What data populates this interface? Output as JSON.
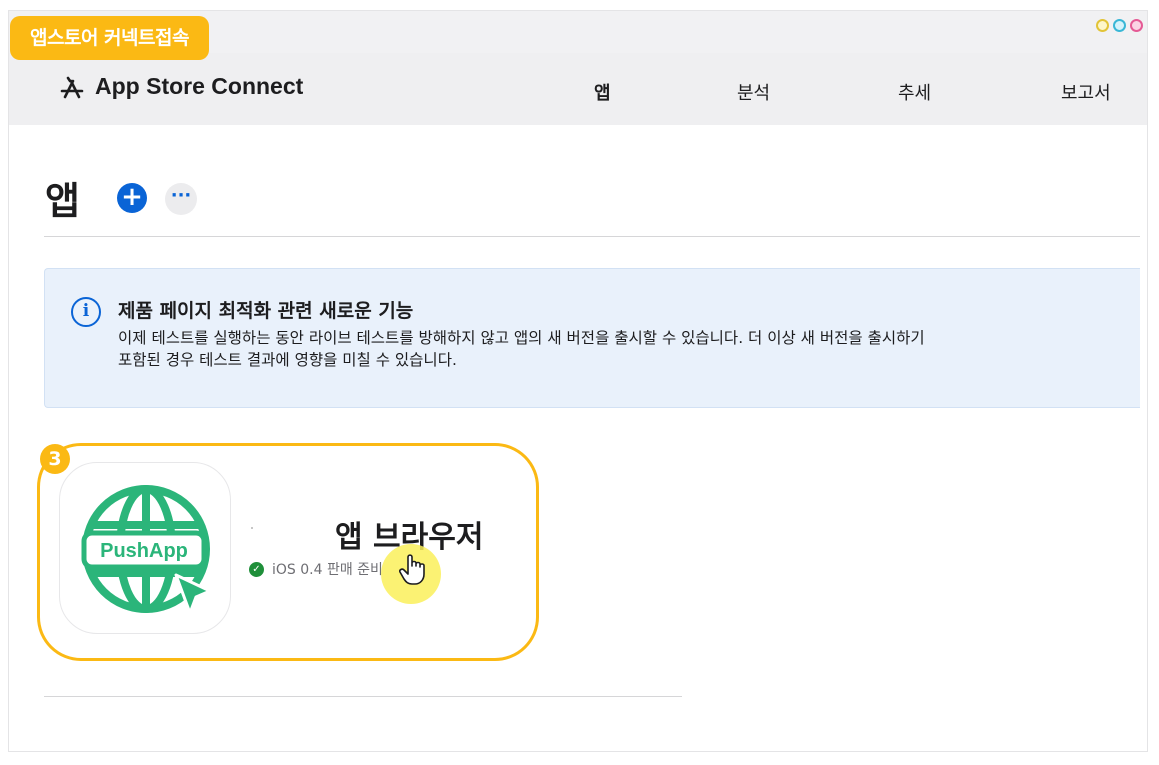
{
  "overlay": {
    "tag_label": "앱스토어 커넥트접속",
    "step_number": "3"
  },
  "header": {
    "brand": "App Store Connect",
    "nav": [
      {
        "label": "앱"
      },
      {
        "label": "분석"
      },
      {
        "label": "추세"
      },
      {
        "label": "보고서"
      }
    ]
  },
  "page": {
    "title": "앱",
    "add_symbol": "+",
    "more_symbol": "···"
  },
  "banner": {
    "info_symbol": "i",
    "title": "제품 페이지 최적화 관련 새로운 기능",
    "line1": "이제 테스트를 실행하는 동안 라이브 테스트를 방해하지 않고 앱의 새 버전을 출시할 수 있습니다. 더 이상 새 버전을 출시하기",
    "line2": "포함된 경우 테스트 결과에 영향을 미칠 수 있습니다."
  },
  "app": {
    "name": "앱 브라우저",
    "icon_label": "PushApp",
    "status": "iOS 0.4 판매 준비",
    "status_check": "✓"
  },
  "colors": {
    "accent_blue": "#0a64d6",
    "highlight_yellow": "#fbb914",
    "app_green": "#2bb57a",
    "status_green": "#1f8f3a"
  }
}
